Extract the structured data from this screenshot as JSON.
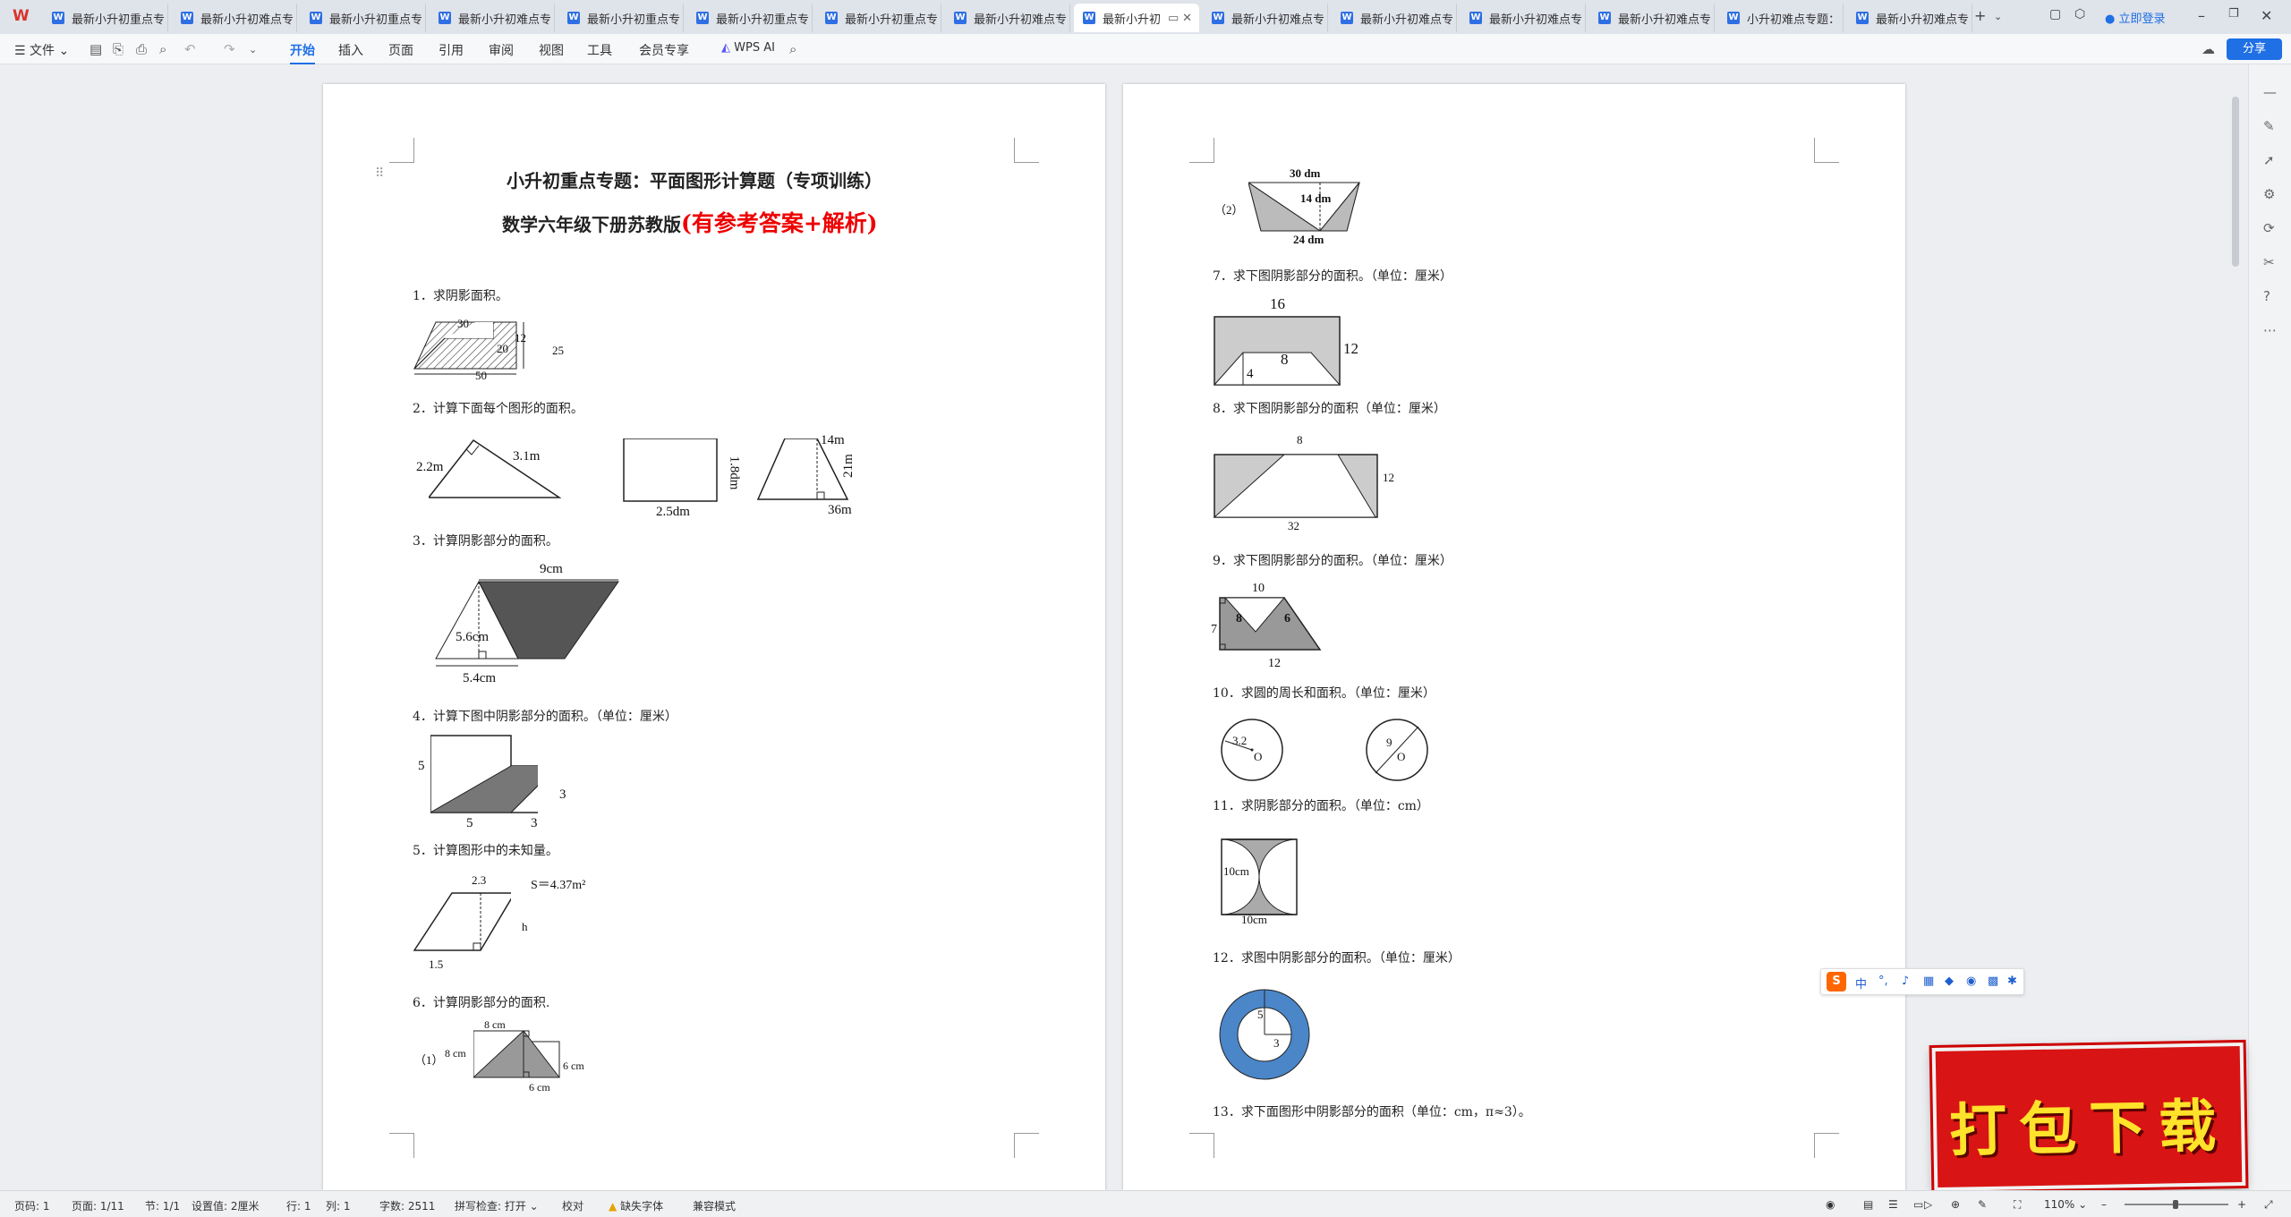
{
  "tabs": [
    {
      "label": "最新小升初重点专"
    },
    {
      "label": "最新小升初难点专"
    },
    {
      "label": "最新小升初重点专"
    },
    {
      "label": "最新小升初难点专"
    },
    {
      "label": "最新小升初重点专"
    },
    {
      "label": "最新小升初重点专"
    },
    {
      "label": "最新小升初重点专"
    },
    {
      "label": "最新小升初难点专"
    },
    {
      "label": "最新小升初"
    },
    {
      "label": "最新小升初难点专"
    },
    {
      "label": "最新小升初难点专"
    },
    {
      "label": "最新小升初难点专"
    },
    {
      "label": "最新小升初难点专"
    },
    {
      "label": "小升初难点专题："
    },
    {
      "label": "最新小升初难点专"
    }
  ],
  "login": "立即登录",
  "toolbar": {
    "file": "文件",
    "menus": [
      "开始",
      "插入",
      "页面",
      "引用",
      "审阅",
      "视图",
      "工具",
      "会员专享"
    ],
    "wps_ai": "WPS AI",
    "share": "分享"
  },
  "doc": {
    "title": "小升初重点专题：平面图形计算题（专项训练）",
    "subtitle_black": "数学六年级下册苏教版",
    "subtitle_red": "(有参考答案+解析)",
    "q1": "1．求阴影面积。",
    "q2": "2．计算下面每个图形的面积。",
    "q3": "3．计算阴影部分的面积。",
    "q4": "4．计算下图中阴影部分的面积。（单位：厘米）",
    "q5": "5．计算图形中的未知量。",
    "q6": "6．计算阴影部分的面积.",
    "q7": "7．求下图阴影部分的面积。（单位：厘米）",
    "q8": "8．求下图阴影部分的面积（单位：厘米）",
    "q9": "9．求下图阴影部分的面积。（单位：厘米）",
    "q10": "10．求圆的周长和面积。（单位：厘米）",
    "q11": "11．求阴影部分的面积。（单位：cm）",
    "q12": "12．求图中阴影部分的面积。（单位：厘米）",
    "q13": "13．求下面图形中阴影部分的面积（单位：cm，π≈3）。",
    "labels": {
      "q1a": "30",
      "q1b": "12",
      "q1c": "20",
      "q1d": "25",
      "q1e": "50",
      "q2a": "2.2m",
      "q2b": "3.1m",
      "q2c": "1.8dm",
      "q2d": "2.5dm",
      "q2e": "14m",
      "q2f": "21m",
      "q2g": "36m",
      "q3a": "9cm",
      "q3b": "5.6cm",
      "q3c": "5.4cm",
      "q4a": "5",
      "q4b": "3",
      "q4c": "5",
      "q4d": "3",
      "q5a": "2.3",
      "q5b": "S＝4.37m²",
      "q5c": "h",
      "q5d": "1.5",
      "q6n1": "（1）",
      "q6a": "8 cm",
      "q6b": "8 cm",
      "q6c": "6 cm",
      "q6d": "6 cm",
      "q6n2": "（2）",
      "q6e": "30 dm",
      "q6f": "14 dm",
      "q6g": "24 dm",
      "q7a": "16",
      "q7b": "12",
      "q7c": "8",
      "q7d": "4",
      "q8a": "8",
      "q8b": "12",
      "q8c": "32",
      "q9a": "10",
      "q9b": "8",
      "q9c": "6",
      "q9d": "7",
      "q9e": "12",
      "q10a": "3.2",
      "q10b": "O",
      "q10c": "9",
      "q10d": "O",
      "q11a": "10cm",
      "q11b": "10cm",
      "q12a": "5",
      "q12b": "3"
    }
  },
  "status": {
    "page": "页码: 1",
    "pages": "页面: 1/11",
    "section": "节: 1/1",
    "setting": "设置值: 2厘米",
    "row": "行: 1",
    "col": "列: 1",
    "words": "字数: 2511",
    "spell": "拼写检查: 打开",
    "proof": "校对",
    "font": "缺失字体",
    "compat": "兼容模式",
    "zoom": "110%"
  },
  "ime": "中",
  "download": "打包下载"
}
